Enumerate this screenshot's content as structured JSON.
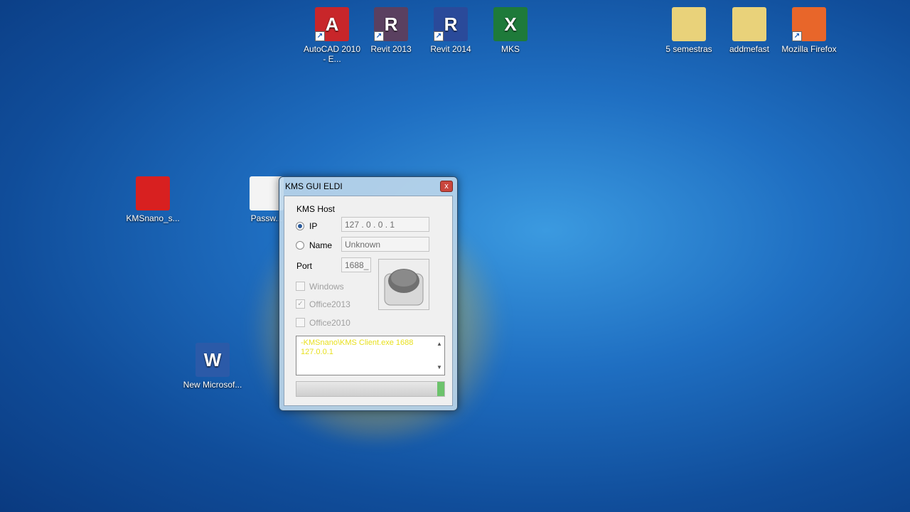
{
  "desktop": {
    "icons": [
      {
        "label": "AutoCAD 2010 - E...",
        "color": "#c8262a",
        "glyph": "A"
      },
      {
        "label": "Revit 2013",
        "color": "#5a4060",
        "glyph": "R"
      },
      {
        "label": "Revit 2014",
        "color": "#2a4a9a",
        "glyph": "R"
      },
      {
        "label": "MKS",
        "color": "#1e7a3a",
        "glyph": "X"
      },
      {
        "label": "5 semestras",
        "color": "#e9d27a",
        "glyph": ""
      },
      {
        "label": "addmefast",
        "color": "#e9d27a",
        "glyph": ""
      },
      {
        "label": "Mozilla Firefox",
        "color": "#e8662a",
        "glyph": ""
      },
      {
        "label": "KMSnano_s...",
        "color": "#d82020",
        "glyph": ""
      },
      {
        "label": "Passw...",
        "color": "#f4f4f4",
        "glyph": ""
      },
      {
        "label": "New Microsof...",
        "color": "#2b5aa8",
        "glyph": "W"
      }
    ]
  },
  "dialog": {
    "title": "KMS GUI ELDI",
    "close": "x",
    "group_label": "KMS Host",
    "ip_label": "IP",
    "ip_value": "127 .  0  .  0  .  1",
    "ip_selected": true,
    "name_label": "Name",
    "name_value": "Unknown",
    "port_label": "Port",
    "port_value": "1688_",
    "checkboxes": [
      {
        "label": "Windows",
        "checked": false
      },
      {
        "label": "Office2013",
        "checked": true
      },
      {
        "label": "Office2010",
        "checked": false
      }
    ],
    "log_text": "-KMSnano\\KMS Client.exe 1688 127.0.0.1",
    "progress_percent": 5
  }
}
